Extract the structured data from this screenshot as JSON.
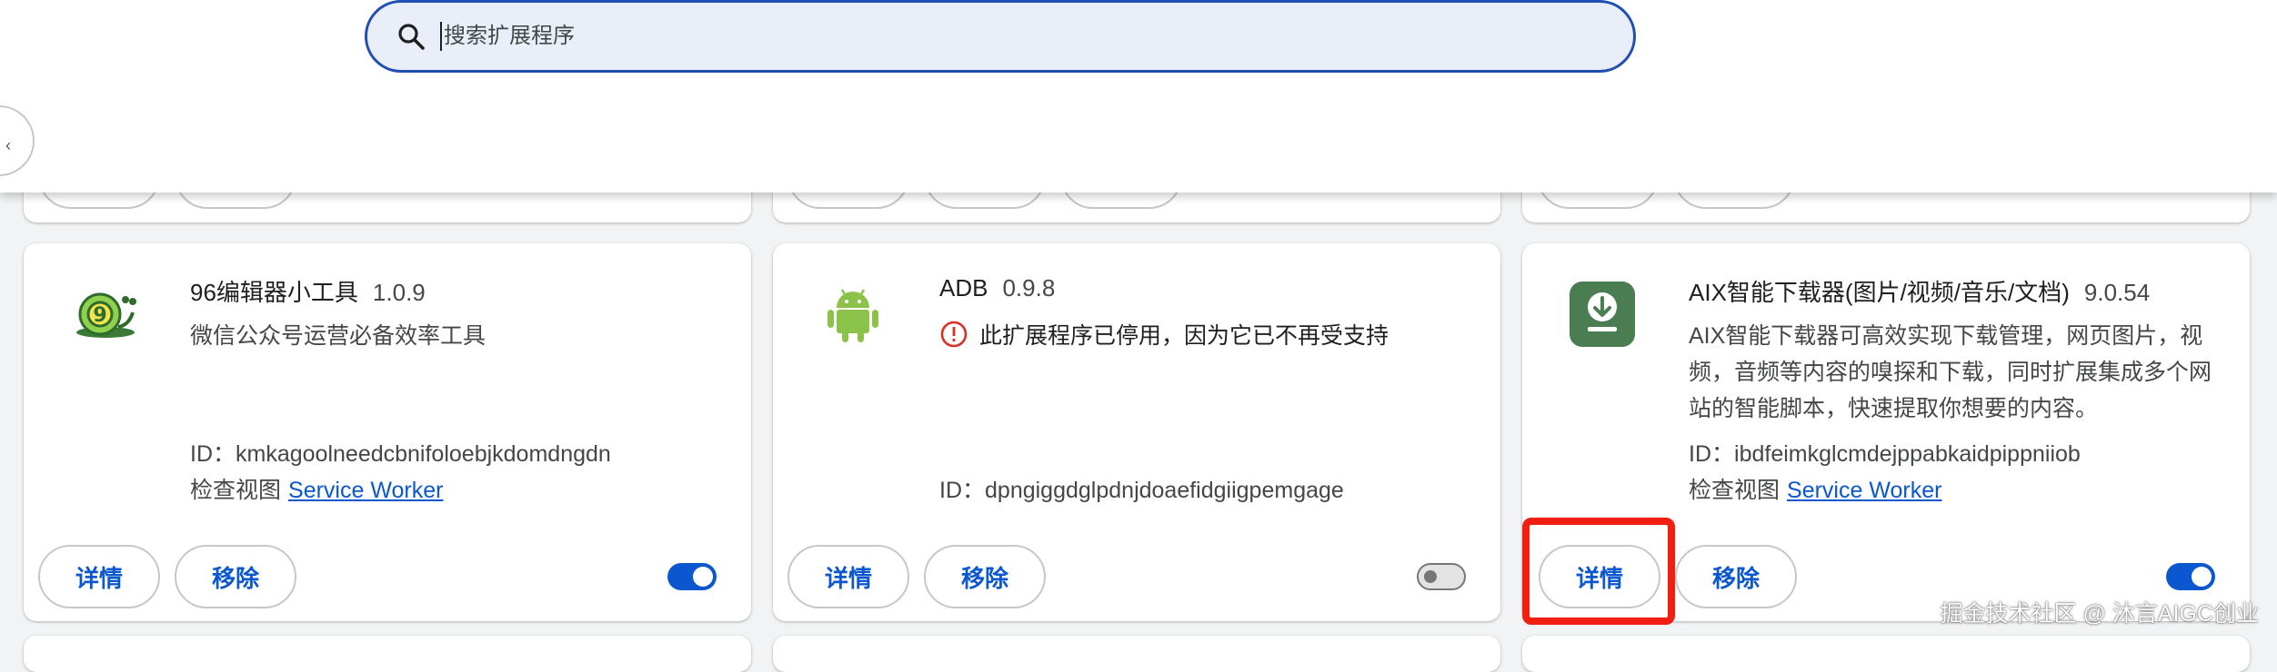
{
  "search": {
    "placeholder": "搜索扩展程序"
  },
  "colors": {
    "accent": "#0b57d0",
    "highlight": "#f01f12",
    "error": "#d93025"
  },
  "cards": [
    {
      "name": "96编辑器小工具",
      "version": "1.0.9",
      "icon": "snail-icon",
      "description": "微信公众号运营必备效率工具",
      "id_label": "ID：",
      "id": "kmkagoolneedcbnifoloebjkdomdngdn",
      "inspect_label": "检查视图",
      "inspect_link": "Service Worker",
      "details_label": "详情",
      "remove_label": "移除",
      "enabled": true
    },
    {
      "name": "ADB",
      "version": "0.9.8",
      "icon": "android-icon",
      "warning": "此扩展程序已停用，因为它已不再受支持",
      "id_label": "ID：",
      "id": "dpngiggdglpdnjdoaefidgiigpemgage",
      "details_label": "详情",
      "remove_label": "移除",
      "enabled": false
    },
    {
      "name": "AIX智能下载器(图片/视频/音乐/文档)",
      "version": "9.0.54",
      "icon": "download-icon",
      "description": "AIX智能下载器可高效实现下载管理，网页图片，视频，音频等内容的嗅探和下载，同时扩展集成多个网站的智能脚本，快速提取你想要的内容。",
      "id_label": "ID：",
      "id": "ibdfeimkglcmdejppabkaidpippniiob",
      "inspect_label": "检查视图",
      "inspect_link": "Service Worker",
      "details_label": "详情",
      "remove_label": "移除",
      "enabled": true
    }
  ],
  "watermark": "掘金技术社区 @ 沐言AIGC创业"
}
